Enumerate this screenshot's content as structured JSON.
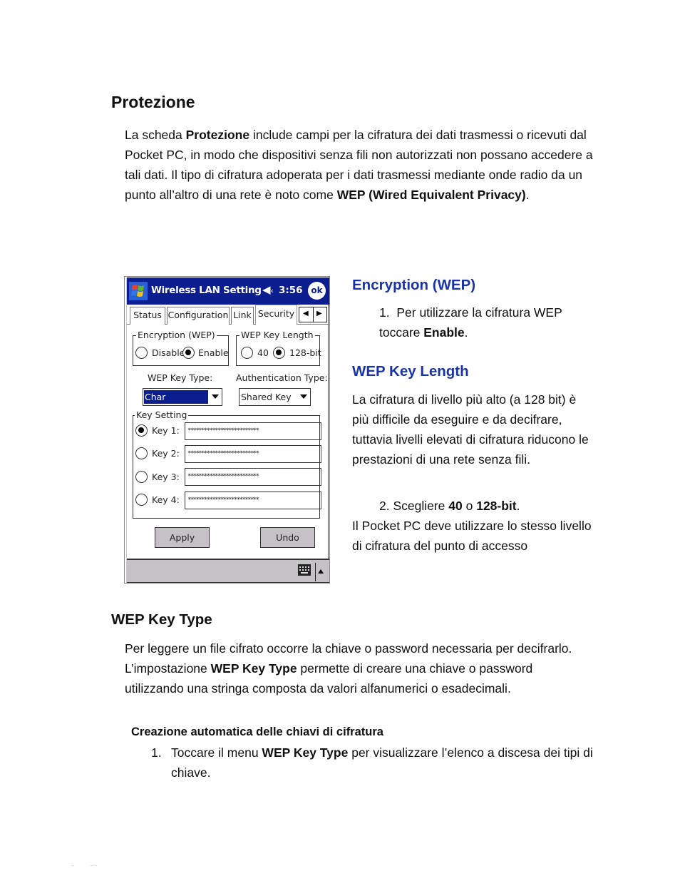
{
  "section": {
    "title": "Protezione",
    "intro": {
      "p1": "La scheda ",
      "b1": "Protezione",
      "p2": " include campi per la cifratura dei dati trasmessi o ricevuti dal Pocket PC, in modo che dispositivi senza fili non autorizzati non possano accedere a tali dati. Il tipo di cifratura adoperata per i dati trasmessi mediante onde radio da un punto all’altro di una rete è noto come ",
      "b2": "WEP (Wired Equivalent Privacy)",
      "p3": "."
    }
  },
  "device": {
    "app_title": "Wireless LAN Setting",
    "time": "3:56",
    "ok_label": "ok",
    "icons": {
      "start": "windows-flag-icon",
      "volume": "speaker-icon",
      "keyboard": "keyboard-icon",
      "sip_toggle": "triangle-up-icon"
    },
    "tabs": [
      {
        "label": "Status",
        "active": false
      },
      {
        "label": "Configuration",
        "active": false
      },
      {
        "label": "Link",
        "active": false
      },
      {
        "label": "Security",
        "active": true
      }
    ],
    "tab_scroll": {
      "left": "◀",
      "right": "▶"
    },
    "encryption": {
      "legend": "Encryption (WEP)",
      "options": [
        {
          "label": "Disable",
          "selected": false
        },
        {
          "label": "Enable",
          "selected": true
        }
      ]
    },
    "key_length": {
      "legend": "WEP Key Length",
      "options": [
        {
          "label": "40",
          "selected": false
        },
        {
          "label": "128-bit",
          "selected": true
        }
      ]
    },
    "key_type": {
      "label": "WEP Key Type:",
      "value": "Char"
    },
    "auth_type": {
      "label": "Authentication Type:",
      "value": "Shared Key"
    },
    "key_setting": {
      "legend": "Key Setting",
      "keys": [
        {
          "label": "Key 1:",
          "value": "**************************",
          "selected": true
        },
        {
          "label": "Key 2:",
          "value": "**************************",
          "selected": false
        },
        {
          "label": "Key 3:",
          "value": "**************************",
          "selected": false
        },
        {
          "label": "Key 4:",
          "value": "**************************",
          "selected": false
        }
      ]
    },
    "buttons": {
      "apply": "Apply",
      "undo": "Undo"
    }
  },
  "encryption_wep": {
    "title": "Encryption (WEP)",
    "step1_num": "1.",
    "step1_text": "Per utilizzare la cifratura WEP toccare ",
    "step1_bold": "Enable",
    "step1_end": "."
  },
  "wep_key_length": {
    "title": "WEP Key Length",
    "body": "La cifratura di livello più alto (a 128 bit) è più difficile da eseguire e da decifrare, tuttavia livelli elevati di cifratura riducono le prestazioni di una rete senza fili.",
    "step2_pre": "2. Scegliere ",
    "step2_b1": "40",
    "step2_mid": " o ",
    "step2_b2": "128-bit",
    "step2_end": ".",
    "note": "Il Pocket PC deve utilizzare lo stesso livello di cifratura del punto di accesso"
  },
  "wep_key_type": {
    "title": "WEP Key Type",
    "p1": "Per leggere un file cifrato occorre la chiave o password necessaria per decifrarlo. L’impostazione ",
    "b1": "WEP Key Type",
    "p2": " permette di creare una chiave o password utilizzando una stringa composta da valori alfanumerici o esadecimali.",
    "subheading": "Creazione automatica delle chiavi di cifratura",
    "step1_num": "1.",
    "step1_pre": "Toccare il menu ",
    "step1_bold": "WEP Key Type",
    "step1_post": " per visualizzare l’elenco a discesa dei tipi di chiave."
  }
}
